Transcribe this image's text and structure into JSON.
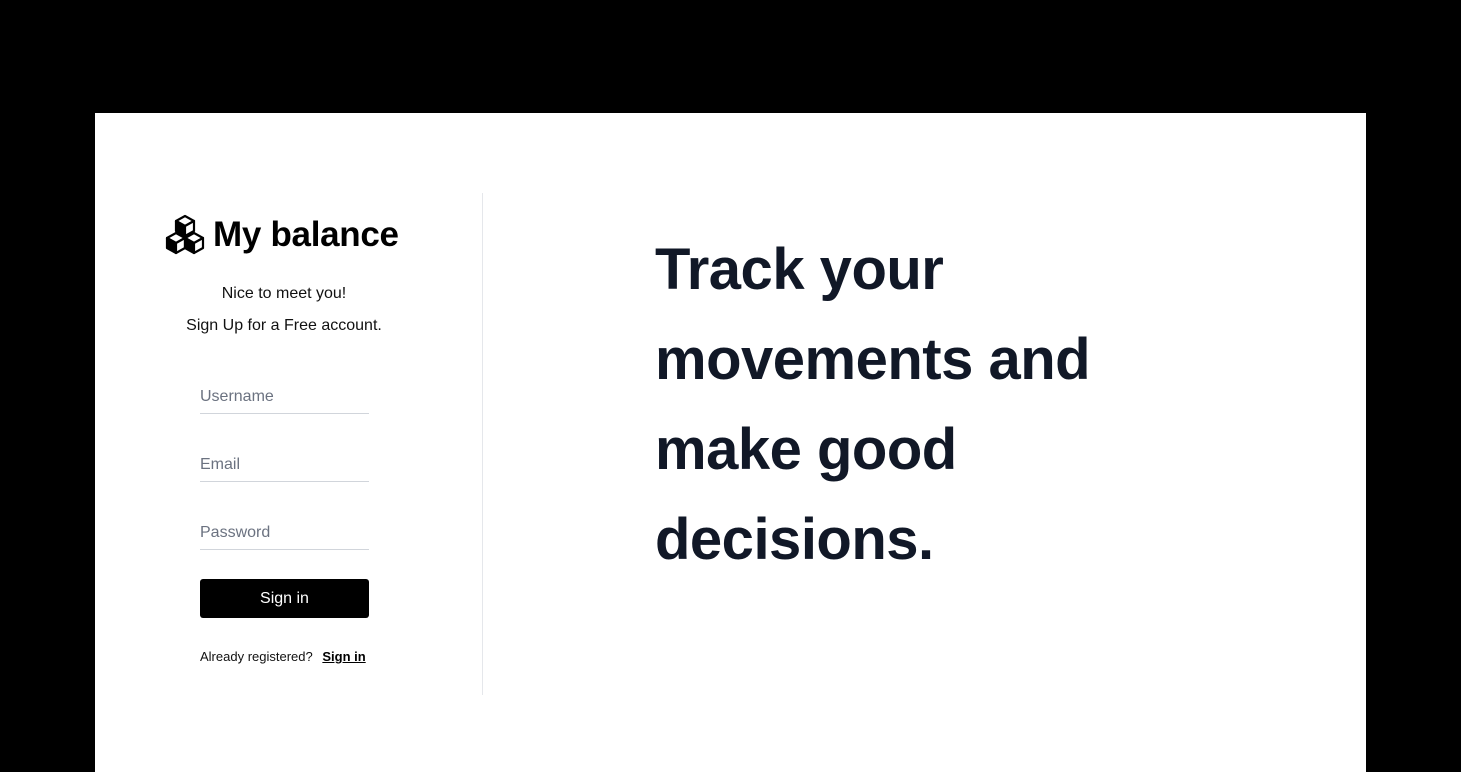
{
  "brand": {
    "icon": "cubes-icon",
    "title": "My balance"
  },
  "intro": {
    "greeting": "Nice to meet you!",
    "subtitle": "Sign Up for a Free account."
  },
  "form": {
    "username": {
      "placeholder": "Username",
      "value": ""
    },
    "email": {
      "placeholder": "Email",
      "value": ""
    },
    "password": {
      "placeholder": "Password",
      "value": ""
    },
    "submit_label": "Sign in"
  },
  "footer": {
    "prompt": "Already registered?",
    "link_label": "Sign in"
  },
  "hero": {
    "headline": "Track your movements and make good decisions."
  },
  "colors": {
    "background": "#000000",
    "card": "#ffffff",
    "button": "#000000",
    "headline": "#111827"
  }
}
